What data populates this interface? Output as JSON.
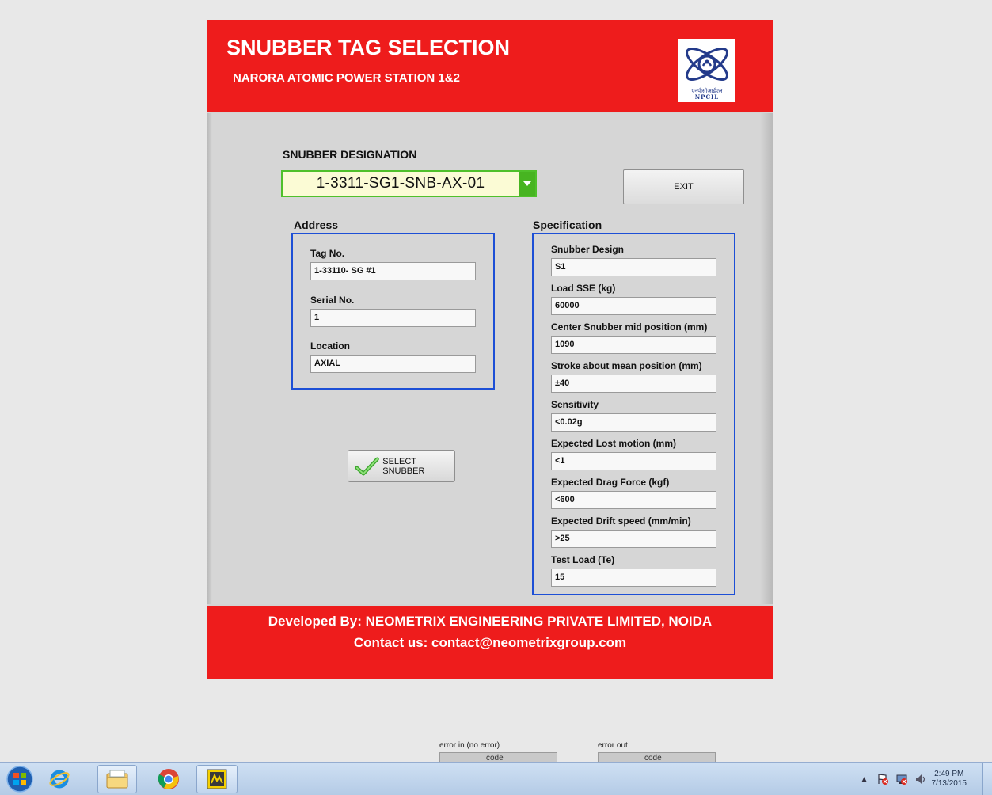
{
  "header": {
    "title": "SNUBBER TAG SELECTION",
    "subtitle": "NARORA ATOMIC POWER STATION 1&2",
    "logo_caption_hindi": "एनपीसीआईएल",
    "logo_caption": "NPCIL"
  },
  "designation": {
    "label": "SNUBBER DESIGNATION",
    "selected_value": "1-3311-SG1-SNB-AX-01"
  },
  "exit_label": "EXIT",
  "address": {
    "title": "Address",
    "fields": [
      {
        "label": "Tag No.",
        "value": "1-33110- SG  #1"
      },
      {
        "label": "Serial No.",
        "value": "1"
      },
      {
        "label": "Location",
        "value": "AXIAL"
      }
    ]
  },
  "specification": {
    "title": "Specification",
    "fields": [
      {
        "label": "Snubber Design",
        "value": "S1"
      },
      {
        "label": "Load SSE (kg)",
        "value": "60000"
      },
      {
        "label": "Center Snubber mid position (mm)",
        "value": "1090"
      },
      {
        "label": "Stroke about mean position (mm)",
        "value": "±40"
      },
      {
        "label": "Sensitivity",
        "value": "<0.02g"
      },
      {
        "label": "Expected Lost motion (mm)",
        "value": "<1"
      },
      {
        "label": "Expected Drag Force (kgf)",
        "value": "<600"
      },
      {
        "label": "Expected Drift speed (mm/min)",
        "value": ">25"
      },
      {
        "label": "Test Load (Te)",
        "value": "15"
      }
    ]
  },
  "select_button_label": "SELECT SNUBBER",
  "footer": {
    "line1": "Developed By: NEOMETRIX ENGINEERING PRIVATE LIMITED, NOIDA",
    "line2": "Contact us: contact@neometrixgroup.com"
  },
  "error_cluster": {
    "error_in_label": "error in (no error)",
    "error_out_label": "error out",
    "partial_text": "code"
  },
  "taskbar": {
    "pinned": [
      "start-orb-icon",
      "internet-explorer-icon",
      "file-explorer-icon",
      "chrome-icon",
      "labview-icon"
    ],
    "time": "2:49 PM",
    "date": "7/13/2015"
  },
  "colors": {
    "header_red": "#ee1c1c",
    "group_border_blue": "#1d4fd6",
    "select_green": "#4fc02b",
    "select_bg": "#fbfbd5"
  }
}
